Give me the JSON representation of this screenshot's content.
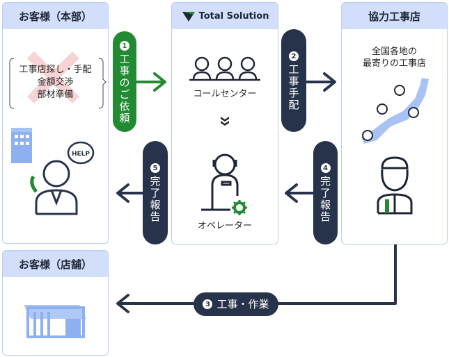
{
  "colors": {
    "header": "#d2defa",
    "border": "#b9ccf2",
    "navy": "#27334a",
    "green": "#218a32",
    "light_blue": "#8fb0f0"
  },
  "hq": {
    "title": "お客様（本部）",
    "tasks": [
      "工事店探し・手配",
      "金額交渉",
      "部材準備"
    ]
  },
  "ts": {
    "brand": "Total Solution",
    "callcenter": "コールセンター",
    "operator": "オペレーター"
  },
  "partner": {
    "title": "協力工事店",
    "caption": [
      "全国各地の",
      "最寄りの工事店"
    ]
  },
  "store": {
    "title": "お客様（店舗）"
  },
  "help": "HELP",
  "steps": [
    {
      "num": "1",
      "label": [
        "工",
        "事",
        "の",
        "ご",
        "依",
        "頼"
      ]
    },
    {
      "num": "2",
      "label": [
        "工",
        "事",
        "手",
        "配"
      ]
    },
    {
      "num": "3",
      "label": "工事・作業"
    },
    {
      "num": "4",
      "label": [
        "完",
        "了",
        "報",
        "告"
      ]
    },
    {
      "num": "5",
      "label": [
        "完",
        "了",
        "報",
        "告"
      ]
    }
  ]
}
